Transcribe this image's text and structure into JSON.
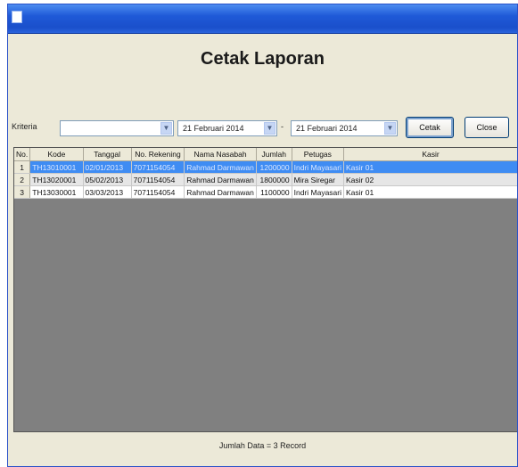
{
  "header": {
    "title": "Cetak Laporan"
  },
  "filter": {
    "label": "Kriteria",
    "criteria_value": "",
    "date_from": "21 Februari 2014",
    "separator": "-",
    "date_to": "21 Februari 2014",
    "print_button": "Cetak",
    "close_button": "Close"
  },
  "table": {
    "columns": [
      "No.",
      "Kode",
      "Tanggal",
      "No. Rekening",
      "Nama Nasabah",
      "Jumlah",
      "Petugas",
      "Kasir"
    ],
    "rows": [
      [
        "1",
        "TH13010001",
        "02/01/2013",
        "7071154054",
        "Rahmad Darmawan",
        "1200000",
        "Indri Mayasari",
        "Kasir 01"
      ],
      [
        "2",
        "TH13020001",
        "05/02/2013",
        "7071154054",
        "Rahmad Darmawan",
        "1800000",
        "Mira Siregar",
        "Kasir 02"
      ],
      [
        "3",
        "TH13030001",
        "03/03/2013",
        "7071154054",
        "Rahmad Darmawan",
        "1100000",
        "Indri Mayasari",
        "Kasir 01"
      ]
    ],
    "selected_row": 0
  },
  "footer": {
    "text": "Jumlah Data = 3 Record"
  }
}
